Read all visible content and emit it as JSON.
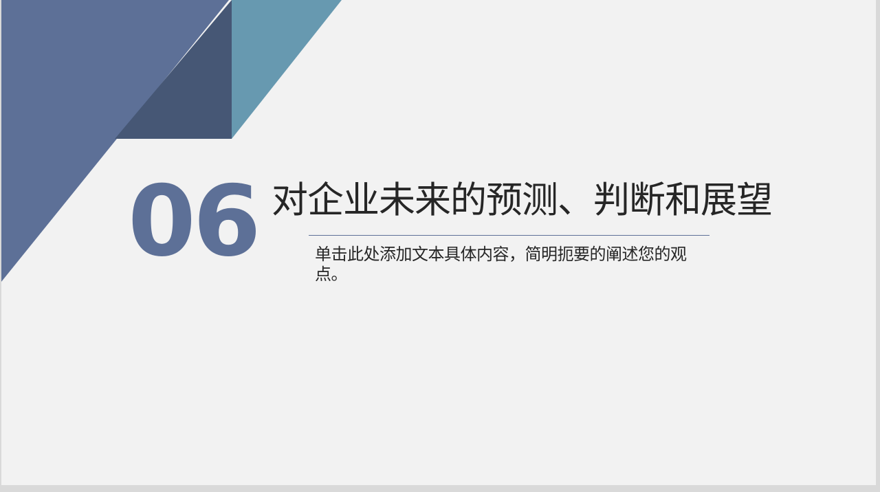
{
  "slide": {
    "number": "06",
    "title": "对企业未来的预测、判断和展望",
    "description": "单击此处添加文本具体内容，简明扼要的阐述您的观点。"
  },
  "colors": {
    "background": "#f2f2f2",
    "primary_blue": "#5d7097",
    "dark_blue": "#465775",
    "teal_blue": "#6799b0",
    "text": "#262626"
  }
}
